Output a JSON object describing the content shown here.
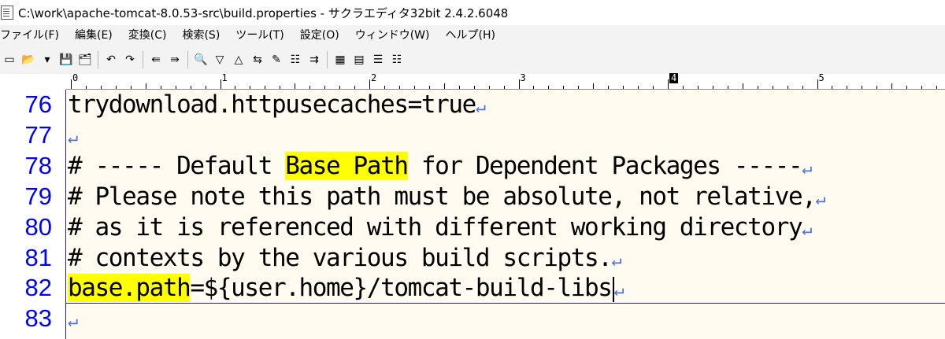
{
  "window": {
    "title": "C:\\work\\apache-tomcat-8.0.53-src\\build.properties - サクラエディタ32bit 2.4.2.6048"
  },
  "menu": [
    "ファイル(F)",
    "編集(E)",
    "変換(C)",
    "検索(S)",
    "ツール(T)",
    "設定(O)",
    "ウィンドウ(W)",
    "ヘルプ(H)"
  ],
  "toolbar": {
    "icons": [
      "new-file-icon",
      "open-folder-icon",
      "dropdown-arrow-icon",
      "save-icon",
      "save-all-icon",
      "undo-icon",
      "redo-icon",
      "jump-back-icon",
      "jump-forward-icon",
      "search-icon",
      "search-next-icon",
      "search-prev-icon",
      "replace-icon",
      "bookmark-icon",
      "grep-icon",
      "tag-jump-icon",
      "compare-icon",
      "outline-icon",
      "function-list-icon",
      "settings-icon"
    ],
    "glyphs": [
      "▭",
      "📂",
      "▾",
      "💾",
      "🗂",
      "↶",
      "↷",
      "⇚",
      "⇛",
      "🔍",
      "▽",
      "△",
      "⇆",
      "✎",
      "☷",
      "⇉",
      "▦",
      "▤",
      "☰",
      "☷"
    ]
  },
  "ruler": {
    "labels": [
      "0",
      "1",
      "2",
      "3",
      "4",
      "5"
    ],
    "current": "4"
  },
  "editor": {
    "lines": [
      {
        "num": "76",
        "pre": "trydownload.httpusecaches=true",
        "hl": "",
        "post": ""
      },
      {
        "num": "77",
        "pre": "",
        "hl": "",
        "post": ""
      },
      {
        "num": "78",
        "pre": "# ----- Default ",
        "hl": "Base Path",
        "post": " for Dependent Packages -----"
      },
      {
        "num": "79",
        "pre": "# Please note this path must be absolute, not relative,",
        "hl": "",
        "post": ""
      },
      {
        "num": "80",
        "pre": "# as it is referenced with different working directory",
        "hl": "",
        "post": ""
      },
      {
        "num": "81",
        "pre": "# contexts by the various build scripts.",
        "hl": "",
        "post": ""
      },
      {
        "num": "82",
        "pre": "",
        "hl": "base.path",
        "post": "=${user.home}/tomcat-build-libs"
      },
      {
        "num": "83",
        "pre": "",
        "hl": "",
        "post": ""
      }
    ],
    "eol_mark": "↵",
    "colors": {
      "line_number": "#0000ff",
      "highlight": "#ffff00",
      "background": "#fffbf0",
      "eol": "#4a74d8"
    }
  }
}
